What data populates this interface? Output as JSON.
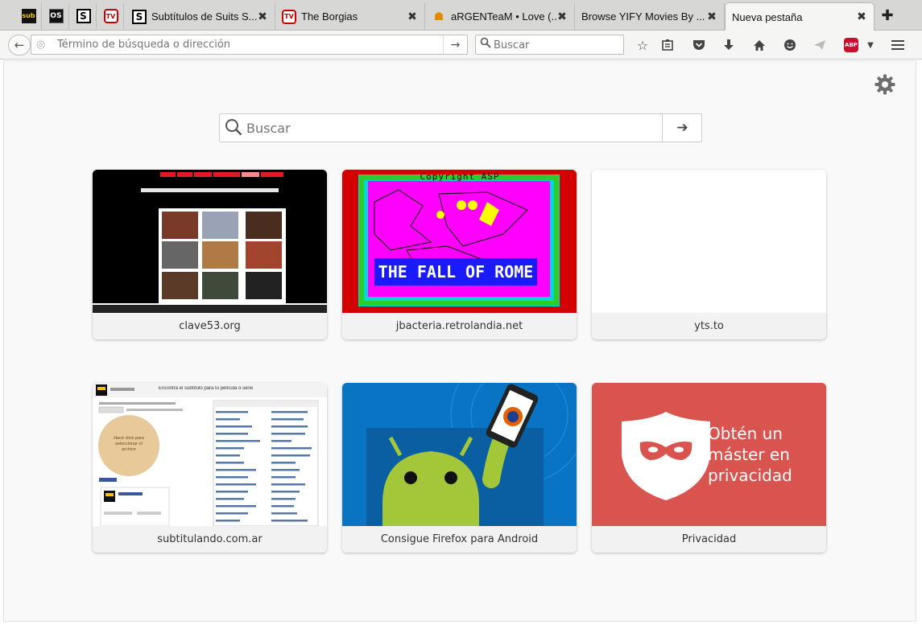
{
  "tabs": {
    "pinned": [
      {
        "icon": "subtitulando-favicon",
        "text": "sub"
      },
      {
        "icon": "opensubtitles-favicon",
        "text": "OS"
      },
      {
        "icon": "series-favicon",
        "text": "S"
      },
      {
        "icon": "tv-favicon",
        "text": "TV"
      }
    ],
    "items": [
      {
        "title": "Subtítulos de Suits S...",
        "icon": "series-favicon",
        "icon_text": "S"
      },
      {
        "title": "The Borgias",
        "icon": "tv-favicon",
        "icon_text": "TV"
      },
      {
        "title": "aRGENTeaM • Love (...",
        "icon": "argenteam-favicon",
        "icon_text": "☗"
      },
      {
        "title": "Browse YIFY Movies By ...",
        "icon": "",
        "icon_text": ""
      },
      {
        "title": "Nueva pestaña",
        "icon": "",
        "icon_text": "",
        "selected": true
      }
    ],
    "close_glyph": "✖",
    "new_tab_glyph": "✚"
  },
  "navbar": {
    "url_placeholder": "Término de búsqueda o dirección",
    "search_placeholder": "Buscar"
  },
  "newtab": {
    "search_placeholder": "Buscar",
    "tiles": [
      {
        "label": "clave53.org"
      },
      {
        "label": "jbacteria.retrolandia.net",
        "thumb_text": "THE FALL OF ROME",
        "border_text": "Copyright ASP"
      },
      {
        "label": "yts.to"
      },
      {
        "label": "subtitulando.com.ar",
        "thumb_text": "Encontrá el subtítulo para tu película o serie",
        "thumb_button": "Hacé click para seleccionar el archivo"
      },
      {
        "label": "Consigue Firefox para Android"
      },
      {
        "label": "Privacidad",
        "thumb_text": "Obtén un máster en privacidad"
      }
    ]
  },
  "colors": {
    "privacy_red": "#d9534f",
    "rome_magenta": "#ff00ff",
    "android_green": "#a4c639",
    "android_blue": "#0a74c4"
  }
}
